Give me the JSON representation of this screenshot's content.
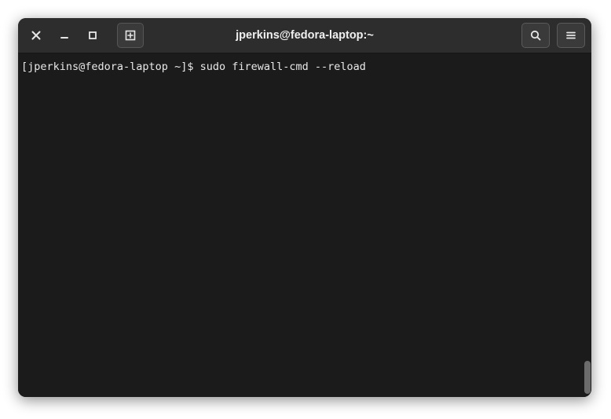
{
  "window": {
    "title": "jperkins@fedora-laptop:~"
  },
  "terminal": {
    "prompt": "[jperkins@fedora-laptop ~]$ ",
    "command": "sudo firewall-cmd --reload"
  }
}
